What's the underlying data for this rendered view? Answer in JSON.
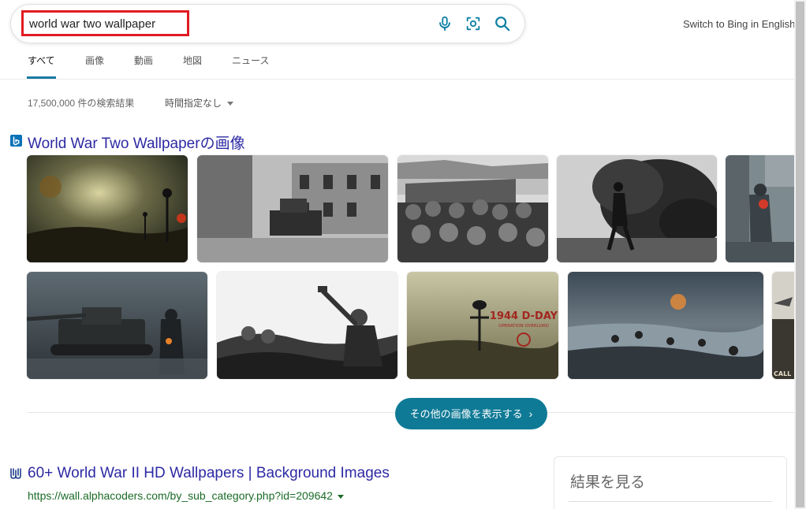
{
  "search": {
    "query": "world war two wallpaper"
  },
  "header": {
    "switch_language": "Switch to Bing in English"
  },
  "tabs": [
    {
      "label": "すべて",
      "active": true
    },
    {
      "label": "画像",
      "active": false
    },
    {
      "label": "動画",
      "active": false
    },
    {
      "label": "地図",
      "active": false
    },
    {
      "label": "ニュース",
      "active": false
    }
  ],
  "results_info": {
    "count": "17,500,000 件の検索結果",
    "time_filter": "時間指定なし"
  },
  "images_section": {
    "title": "World War Two Wallpaperの画像",
    "more_button": "その他の画像を表示する"
  },
  "first_result": {
    "title": "60+ World War II HD Wallpapers | Background Images",
    "url": "https://wall.alphacoders.com/by_sub_category.php?id=209642"
  },
  "side_panel": {
    "title": "結果を見る"
  },
  "image_texts": {
    "dday_line1": "1944 D-DAY",
    "dday_line2": "OPERATION OVERLORD",
    "game_logo": "CALL"
  },
  "colors": {
    "accent": "#1a7aa3",
    "link": "#2d2aa3",
    "url_green": "#1a6b27",
    "button": "#0f7a96",
    "highlight_box": "#e01b22"
  }
}
